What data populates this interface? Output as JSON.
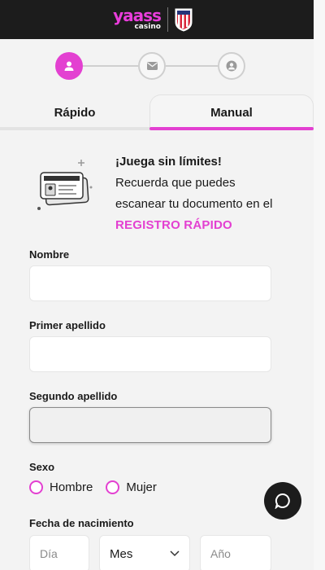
{
  "header": {
    "brand_main": "yaass",
    "brand_sub": "casino",
    "partner_logo": "atletico-crest-icon"
  },
  "stepper": {
    "steps": [
      {
        "icon": "user-icon",
        "state": "active"
      },
      {
        "icon": "envelope-icon",
        "state": "inactive"
      },
      {
        "icon": "user-circle-icon",
        "state": "inactive"
      }
    ]
  },
  "tabs": {
    "rapido": "Rápido",
    "manual": "Manual",
    "active": "Manual"
  },
  "promo": {
    "title": "¡Juega sin límites!",
    "line1": "Recuerda que puedes",
    "line2": "escanear tu documento en el",
    "link": "REGISTRO RÁPIDO"
  },
  "form": {
    "nombre_label": "Nombre",
    "nombre_value": "",
    "primer_apellido_label": "Primer apellido",
    "primer_apellido_value": "",
    "segundo_apellido_label": "Segundo apellido",
    "segundo_apellido_value": "",
    "sexo_label": "Sexo",
    "sexo_options": [
      "Hombre",
      "Mujer"
    ],
    "fecha_label": "Fecha de nacimiento",
    "dia_placeholder": "Día",
    "mes_value": "Mes",
    "anio_placeholder": "Año"
  },
  "colors": {
    "accent": "#e340d1",
    "header_bg": "#1c1c1c",
    "page_bg": "#f3f3f3"
  },
  "chat": {
    "icon": "chat-bubble-icon"
  }
}
